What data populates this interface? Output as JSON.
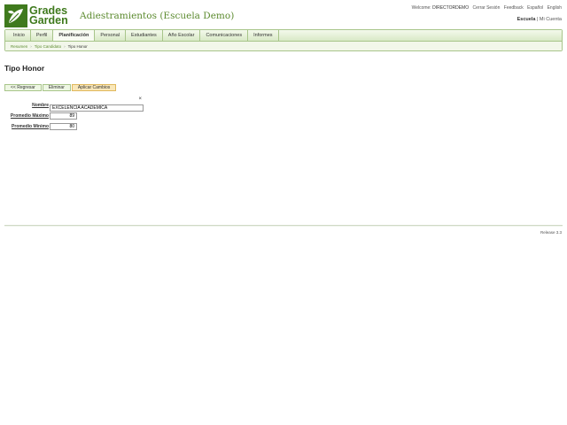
{
  "header": {
    "logo_line1": "Grades",
    "logo_line2": "Garden",
    "school_title": "Adiestramientos (Escuela Demo)",
    "welcome_prefix": "Welcome:",
    "welcome_user": "DIRECTORDEMO",
    "links": [
      "Cerrar Sesión",
      "Feedback",
      "Español",
      "English"
    ],
    "school_label": "Escuela",
    "account_link": "Mi Cuenta"
  },
  "nav": {
    "tabs": [
      "Inicio",
      "Perfil",
      "Planificación",
      "Personal",
      "Estudiantes",
      "Año Escolar",
      "Comunicaciones",
      "Informes"
    ],
    "active_index": 2
  },
  "breadcrumb": {
    "items": [
      "Resumen",
      "Tipo Candidato",
      "Tipo Honor"
    ]
  },
  "page": {
    "title": "Tipo Honor",
    "buttons": {
      "back": "<< Regresar",
      "delete": "Eliminar",
      "apply": "Aplicar Cambios"
    },
    "form": {
      "name_label": "Nombre",
      "name_value": "EXCELENCIA ACADEMICA",
      "max_label": "Promedio Máximo",
      "max_value": "89",
      "min_label": "Promedio Mínimo",
      "min_value": "80"
    }
  },
  "footer": {
    "release": "Release 3.3"
  },
  "colors": {
    "brand_green": "#3f7a1d",
    "nav_border": "#a8c58a",
    "apply_button": "#f9e7b9"
  }
}
